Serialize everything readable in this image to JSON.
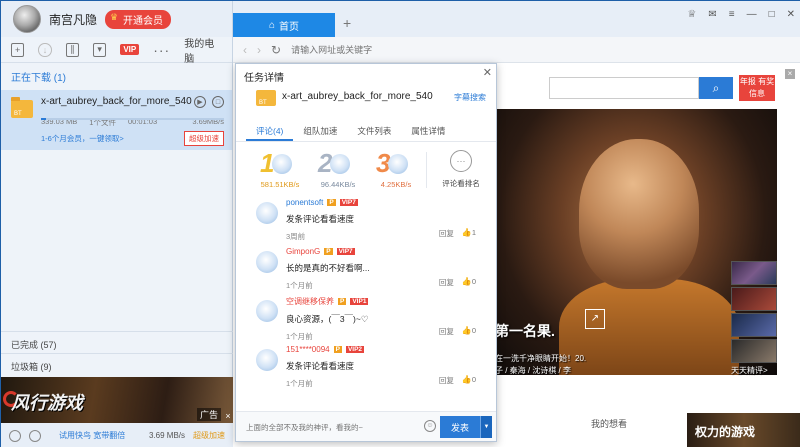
{
  "user": {
    "name": "南宫凡隐",
    "vip_button": "开通会员"
  },
  "toolbar": {
    "vip_badge": "VIP",
    "my_pc": "我的电脑"
  },
  "downloads": {
    "section": "正在下载 (1)",
    "task": {
      "name": "x-art_aubrey_back_for_more_540",
      "size": "339.03 MB",
      "file_count": "1个文件",
      "time": "00:01:03",
      "speed": "3.69MB/s",
      "progress": 0.03,
      "promo": "1-6个月会员，一键领取>",
      "accel_button": "超级加速"
    },
    "completed": "已完成 (57)",
    "trash": "垃圾箱 (9)"
  },
  "ad": {
    "logo": "风行游戏",
    "tag": "广告",
    "close": "×"
  },
  "status_bar": {
    "trial": "试用快鸟 宽带翻倍",
    "speed": "3.69 MB/s",
    "accel": "超级加速"
  },
  "browser": {
    "tab_home": "首页",
    "address_placeholder": "请输入网址或关键字",
    "promo_link": "年报 有奖信息",
    "hero_caption": "第一名果.",
    "hero_sub_1": "在一洗千净眼睛开始！20.",
    "hero_sub_2": "子 / 秦海 / 沈诗棋 / 李",
    "thumbs_label": "天天精评>",
    "my_watch": "我的想看",
    "bottom_ad": "权力的游戏"
  },
  "popup": {
    "title": "任务详情",
    "file_name": "x-art_aubrey_back_for_more_540",
    "subtitle_link": "字幕搜索",
    "tabs": [
      "评论(4)",
      "组队加速",
      "文件列表",
      "属性详情"
    ],
    "top3": [
      {
        "rank": "1",
        "speed": "581.51KB/s"
      },
      {
        "rank": "2",
        "speed": "96.44KB/s"
      },
      {
        "rank": "3",
        "speed": "4.25KB/s"
      }
    ],
    "leaderboard_label": "评论看排名",
    "comments": [
      {
        "user": "ponentsoft",
        "p": "P",
        "vip": "VIP7",
        "text": "发条评论看看速度",
        "time": "3周前",
        "reply": "回复",
        "likes": "1"
      },
      {
        "user": "GimponG",
        "p": "P",
        "vip": "VIP7",
        "text": "长的是真的不好看啊...",
        "time": "1个月前",
        "reply": "回复",
        "likes": "0"
      },
      {
        "user": "空调继移保养",
        "p": "P",
        "vip": "VIP1",
        "text": "良心资源，(￣3￣)~♡",
        "time": "1个月前",
        "reply": "回复",
        "likes": "0"
      },
      {
        "user": "151****0094",
        "p": "P",
        "vip": "VIP2",
        "text": "发条评论看看速度",
        "time": "1个月前",
        "reply": "回复",
        "likes": "0"
      }
    ],
    "composer_placeholder": "上面的全部不及我的神评，看我的~",
    "send_button": "发表"
  }
}
